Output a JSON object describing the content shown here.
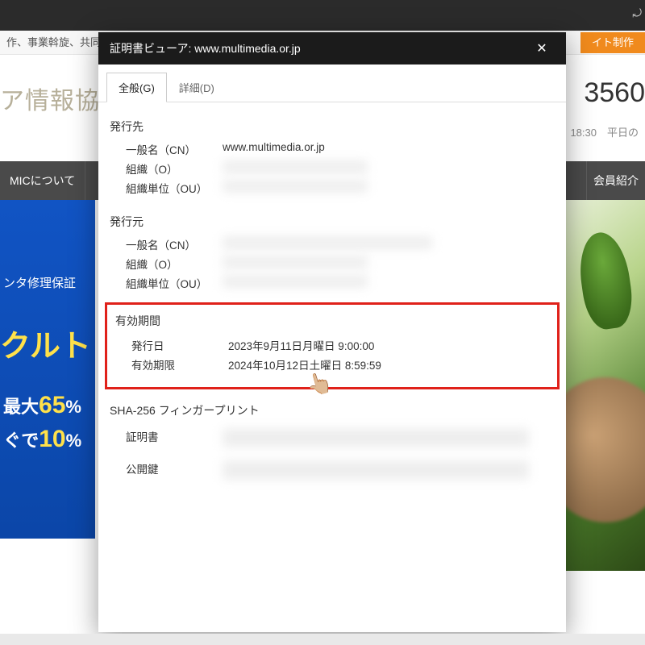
{
  "browser": {
    "corner_glyph": "⤾"
  },
  "background": {
    "strip_text": "作、事業斡旋、共同購買",
    "orange_button": "イト制作",
    "logo_fragment": "ア情報協",
    "phone_fragment": "3560",
    "hours_fragment": "18:30　平日の",
    "nav_left": "MICについて",
    "nav_right": "会員紹介",
    "hero": {
      "line1": "ンタ修理保証",
      "line2": "クルト",
      "line3_pre": "最大",
      "line3_pct": "65",
      "line3_suf": "%",
      "line4_pre": "ぐで",
      "line4_pct": "10",
      "line4_suf": "%"
    }
  },
  "modal": {
    "title": "証明書ビューア: www.multimedia.or.jp",
    "tabs": {
      "general": "全般(G)",
      "details": "詳細(D)"
    },
    "issued_to": {
      "title": "発行先",
      "cn_label": "一般名（CN）",
      "cn_value": "www.multimedia.or.jp",
      "o_label": "組織（O）",
      "ou_label": "組織単位（OU）"
    },
    "issued_by": {
      "title": "発行元",
      "cn_label": "一般名（CN）",
      "o_label": "組織（O）",
      "ou_label": "組織単位（OU）"
    },
    "period": {
      "title": "有効期間",
      "issued_label": "発行日",
      "issued_value": "2023年9月11日月曜日 9:00:00",
      "expires_label": "有効期限",
      "expires_value": "2024年10月12日土曜日 8:59:59"
    },
    "sha": {
      "title": "SHA-256 フィンガープリント",
      "cert_label": "証明書",
      "pubkey_label": "公開鍵"
    },
    "pointer_emoji": "👆🏼"
  }
}
